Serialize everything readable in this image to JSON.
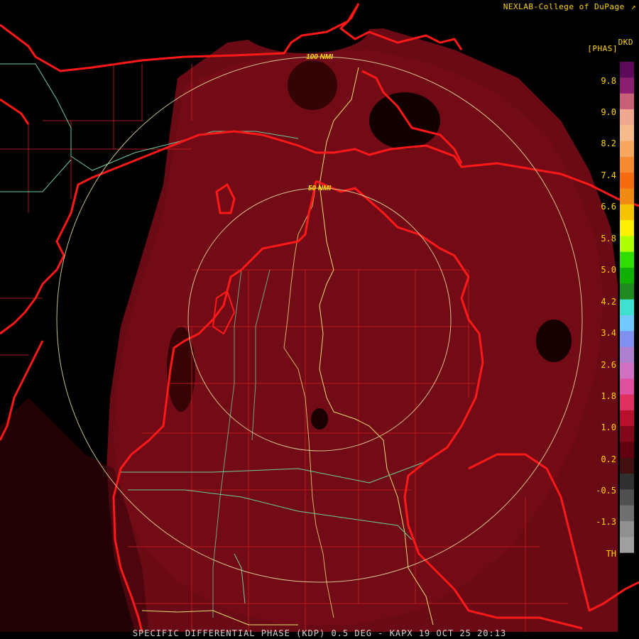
{
  "header": {
    "credit": "NEXLAB-College of DuPage",
    "credit_icon": "external-link-icon",
    "product_code": "DKD",
    "units": "[PHAS]"
  },
  "range_rings": [
    {
      "label": "100 NMI"
    },
    {
      "label": "50 NMI"
    }
  ],
  "legend": {
    "ticks": [
      "9.8",
      "9.0",
      "8.2",
      "7.4",
      "6.6",
      "5.8",
      "5.0",
      "4.2",
      "3.4",
      "2.6",
      "1.8",
      "1.0",
      "0.2",
      "-0.5",
      "-1.3",
      "TH"
    ],
    "colors": [
      "#5e0a5a",
      "#8b1e6e",
      "#c9607a",
      "#f0a890",
      "#f6bb8a",
      "#f6a860",
      "#f68a30",
      "#f66a10",
      "#f08a10",
      "#f4c400",
      "#fff000",
      "#b0ff00",
      "#30dd00",
      "#10b000",
      "#208a20",
      "#40e0d0",
      "#70c8ff",
      "#8090f0",
      "#b080d0",
      "#d070c0",
      "#e050a0",
      "#e03060",
      "#b8102c",
      "#800818",
      "#600010",
      "#401010",
      "#303030",
      "#505050",
      "#707070",
      "#909090",
      "#a0a0a0",
      "#000000"
    ]
  },
  "footer": {
    "caption": "SPECIFIC DIFFERENTIAL PHASE (KDP) 0.5 DEG - KAPX 19 OCT 25 20:13"
  },
  "colors": {
    "echo": "#6b0a14",
    "echo_dark": "#4a0508",
    "coast": "#ff1a1a",
    "county": "#d02020",
    "road_highway": "#e8e070",
    "road_state": "#70c8a0",
    "ring": "#e8e0a0",
    "text": "#ffd400"
  }
}
